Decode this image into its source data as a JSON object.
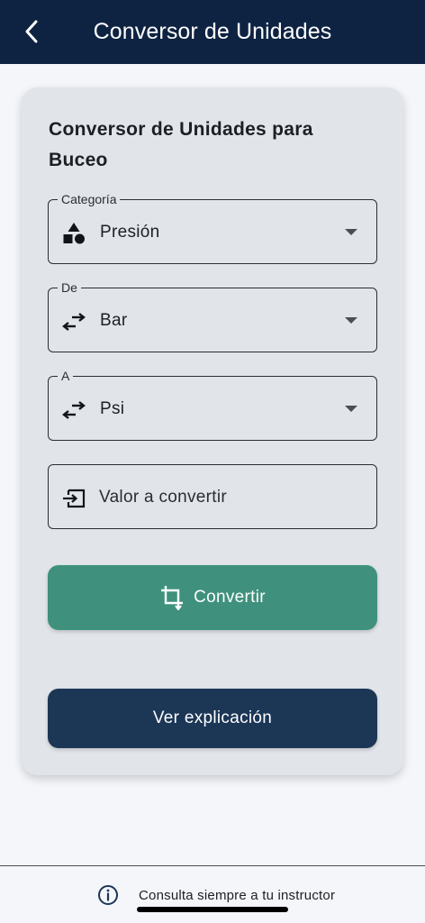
{
  "app_bar": {
    "title": "Conversor de Unidades",
    "back_icon": "chevron-left-icon"
  },
  "card": {
    "title": "Conversor de Unidades para Buceo",
    "fields": {
      "category": {
        "label": "Categoría",
        "value": "Presión",
        "icon": "shapes-icon"
      },
      "from": {
        "label": "De",
        "value": "Bar",
        "icon": "swap-horiz-icon"
      },
      "to": {
        "label": "A",
        "value": "Psi",
        "icon": "swap-horiz-icon"
      },
      "value_input": {
        "placeholder": "Valor a convertir",
        "value": "",
        "icon": "input-icon"
      }
    },
    "convert_button": {
      "label": "Convertir",
      "icon": "crop-icon"
    },
    "explain_button": {
      "label": "Ver explicación"
    }
  },
  "footer": {
    "text": "Consulta siempre a tu instructor",
    "icon": "info-icon"
  },
  "colors": {
    "app_bar": "#0e2342",
    "card_bg": "#e1e5ea",
    "convert_button": "#3f917d",
    "explain_button": "#1c3656",
    "page_bg": "#f4f6fa"
  }
}
